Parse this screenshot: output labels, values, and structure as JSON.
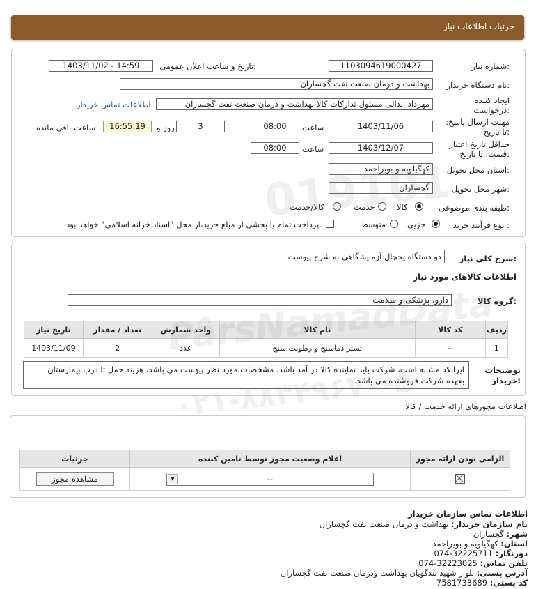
{
  "header": {
    "title": "جزئیات اطلاعات نیاز"
  },
  "form": {
    "need_number_label": "شماره نیاز:",
    "need_number": "1103094619000427",
    "announce_label": "تاریخ و ساعت اعلان عمومی:",
    "announce_value": "1403/11/02 - 14:59",
    "buyer_label": "نام دستگاه خریدار:",
    "buyer_value": "بهداشت و درمان صنعت نفت گچساران",
    "creator_label": "ایجاد کننده درخواست:",
    "creator_value": "مهرداد ابدالی مسئول تدارکات کالا  بهداشت و درمان صنعت نفت گچساران",
    "contact_link": "اطلاعات تماس خریدار",
    "deadline_label": "مهلت ارسال پاسخ: تا تاریخ:",
    "deadline_date": "1403/11/06",
    "hour_label": "ساعت",
    "deadline_time": "08:00",
    "days_value": "3",
    "days_label": "روز و",
    "remaining_time": "16:55:19",
    "remaining_label": "ساعت باقی مانده",
    "validity_label": "حداقل تاریخ اعتبار قیمت: تا تاریخ:",
    "validity_date": "1403/12/07",
    "validity_time": "08:00",
    "province_label": "استان محل تحویل:",
    "province_value": "کهگیلویه و بویراحمد",
    "city_label": "شهر محل تحویل:",
    "city_value": "گچساران",
    "category_label": "طبقه بندی موضوعی:",
    "category_options": [
      "کالا",
      "خدمت",
      "کالا/خدمت"
    ],
    "category_selected": "کالا",
    "process_label": "نوع فرآیند خرید :",
    "process_options": [
      "جزیی",
      "متوسط"
    ],
    "process_selected": "جزیی",
    "treasury_text": "پرداخت تمام یا بخشی از مبلغ خرید،از محل \"اسناد خزانه اسلامی\" خواهد بود."
  },
  "summary": {
    "desc_label": "شرح کلي نياز:",
    "desc_value": "دو دستگاه یخچال آزمایشگاهی به شرح پیوست",
    "items_title": "اطلاعات کالاهای مورد نیاز",
    "group_label": "گروه کالا:",
    "group_value": "دارو، پزشکی و سلامت",
    "table_headers": [
      "ردیف",
      "کد کالا",
      "نام کالا",
      "واحد شمارش",
      "تعداد / مقدار",
      "تاریخ نیاز"
    ],
    "table_rows": [
      [
        "1",
        "--",
        "تستر دماسنج و رطوبت سنج",
        "عدد",
        "2",
        "1403/11/09"
      ]
    ],
    "notes_label": "توضیحات خریدار:",
    "notes_value": "ایرانکد مشابه است، شرکت باید نماینده کالا در آمد باشد، مشخصات مورد نظر پیوست می باشد، هزینه حمل تا درب بیمارستان بعهده شرکت فروشنده می باشد."
  },
  "permits": {
    "title": "اطلاعات مجوزهای ارائه خدمت / کالا",
    "headers": [
      "الزامی بودن ارائه مجوز",
      "اعلام وضعیت مجوز توسط تامین کننده",
      "جزئیات"
    ],
    "select_value": "--",
    "view_button": "مشاهده مجوز"
  },
  "contact": {
    "title": "اطلاعات تماس سازمان خریدار",
    "org_label": "نام سازمان خریدار:",
    "org_value": "بهداشت و درمان صنعت نفت گچساران",
    "city_label": "شهر:",
    "city_value": "گچساران",
    "province_label": "استان:",
    "province_value": "کهگیلویه و بویراحمد",
    "fax_label": "دورنگار:",
    "fax_value": "074-32225711",
    "phone_label": "تلفن تماس:",
    "phone_value": "074-32223025",
    "address_label": "آدرس پستی:",
    "address_value": "بلوار شهید تندگویان بهداشت ودرمان صنعت نفت گچساران",
    "postal_label": "کد پستی:",
    "postal_value": "7581733689"
  },
  "watermark": {
    "number": "019101",
    "brand": "PârsNamadData",
    "phone": "۰۲۱-۸۸۳۴۹۶۷۰-۵"
  }
}
